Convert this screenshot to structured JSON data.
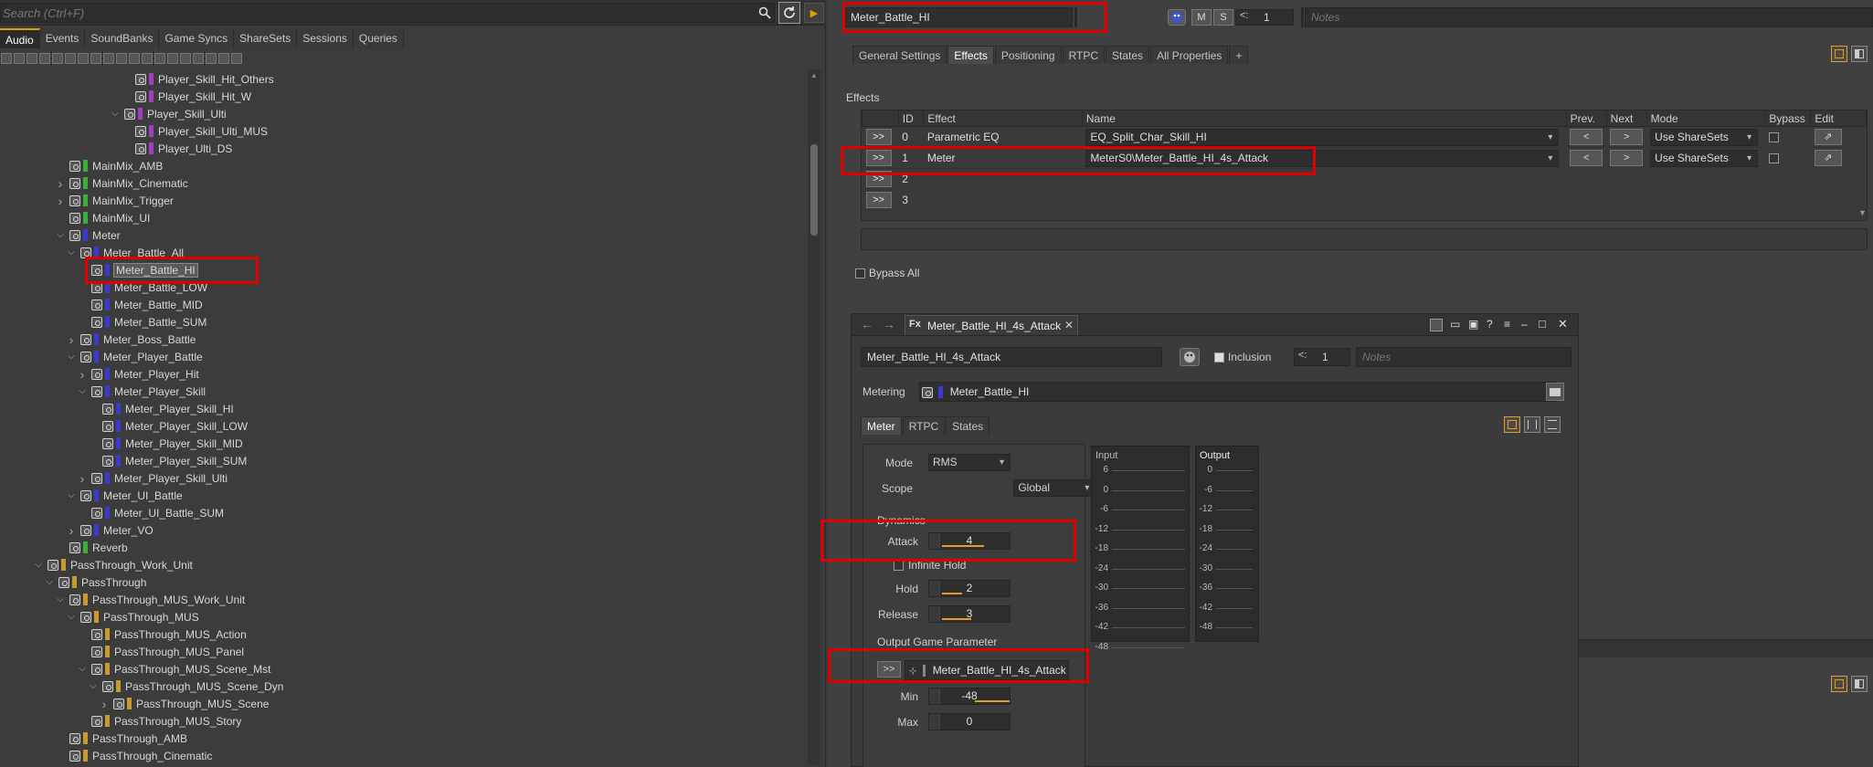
{
  "left": {
    "search_placeholder": "Search (Ctrl+F)",
    "tabs": [
      "Audio",
      "Events",
      "SoundBanks",
      "Game Syncs",
      "ShareSets",
      "Sessions",
      "Queries"
    ],
    "tree": [
      {
        "label": "Player_Skill_Hit_Others",
        "indent": 11,
        "color": "#a040c0",
        "twisty": ""
      },
      {
        "label": "Player_Skill_Hit_W",
        "indent": 11,
        "color": "#a040c0",
        "twisty": ""
      },
      {
        "label": "Player_Skill_Ulti",
        "indent": 10,
        "color": "#a040c0",
        "twisty": "v"
      },
      {
        "label": "Player_Skill_Ulti_MUS",
        "indent": 11,
        "color": "#a040c0",
        "twisty": ""
      },
      {
        "label": "Player_Ulti_DS",
        "indent": 11,
        "color": "#a040c0",
        "twisty": ""
      },
      {
        "label": "MainMix_AMB",
        "indent": 5,
        "color": "#3cae3c",
        "twisty": ""
      },
      {
        "label": "MainMix_Cinematic",
        "indent": 5,
        "color": "#3cae3c",
        "twisty": ">"
      },
      {
        "label": "MainMix_Trigger",
        "indent": 5,
        "color": "#3cae3c",
        "twisty": ">"
      },
      {
        "label": "MainMix_UI",
        "indent": 5,
        "color": "#3cae3c",
        "twisty": ""
      },
      {
        "label": "Meter",
        "indent": 5,
        "color": "#3a3ad0",
        "twisty": "v"
      },
      {
        "label": "Meter_Battle_All",
        "indent": 6,
        "color": "#3a3ad0",
        "twisty": "v"
      },
      {
        "label": "Meter_Battle_HI",
        "indent": 7,
        "color": "#3a3ad0",
        "twisty": "",
        "selected": true
      },
      {
        "label": "Meter_Battle_LOW",
        "indent": 7,
        "color": "#3a3ad0",
        "twisty": ""
      },
      {
        "label": "Meter_Battle_MID",
        "indent": 7,
        "color": "#3a3ad0",
        "twisty": ""
      },
      {
        "label": "Meter_Battle_SUM",
        "indent": 7,
        "color": "#3a3ad0",
        "twisty": ""
      },
      {
        "label": "Meter_Boss_Battle",
        "indent": 6,
        "color": "#3a3ad0",
        "twisty": ">"
      },
      {
        "label": "Meter_Player_Battle",
        "indent": 6,
        "color": "#3a3ad0",
        "twisty": "v"
      },
      {
        "label": "Meter_Player_Hit",
        "indent": 7,
        "color": "#3a3ad0",
        "twisty": ">"
      },
      {
        "label": "Meter_Player_Skill",
        "indent": 7,
        "color": "#3a3ad0",
        "twisty": "v"
      },
      {
        "label": "Meter_Player_Skill_HI",
        "indent": 8,
        "color": "#3a3ad0",
        "twisty": ""
      },
      {
        "label": "Meter_Player_Skill_LOW",
        "indent": 8,
        "color": "#3a3ad0",
        "twisty": ""
      },
      {
        "label": "Meter_Player_Skill_MID",
        "indent": 8,
        "color": "#3a3ad0",
        "twisty": ""
      },
      {
        "label": "Meter_Player_Skill_SUM",
        "indent": 8,
        "color": "#3a3ad0",
        "twisty": ""
      },
      {
        "label": "Meter_Player_Skill_Ulti",
        "indent": 7,
        "color": "#3a3ad0",
        "twisty": ">"
      },
      {
        "label": "Meter_UI_Battle",
        "indent": 6,
        "color": "#3a3ad0",
        "twisty": "v"
      },
      {
        "label": "Meter_UI_Battle_SUM",
        "indent": 7,
        "color": "#3a3ad0",
        "twisty": ""
      },
      {
        "label": "Meter_VO",
        "indent": 6,
        "color": "#3a3ad0",
        "twisty": ">"
      },
      {
        "label": "Reverb",
        "indent": 5,
        "color": "#3cae3c",
        "twisty": ""
      },
      {
        "label": "PassThrough_Work_Unit",
        "indent": 3,
        "color": "#c99a30",
        "twisty": "v"
      },
      {
        "label": "PassThrough",
        "indent": 4,
        "color": "#c99a30",
        "twisty": "v"
      },
      {
        "label": "PassThrough_MUS_Work_Unit",
        "indent": 5,
        "color": "#c99a30",
        "twisty": "v"
      },
      {
        "label": "PassThrough_MUS",
        "indent": 6,
        "color": "#c99a30",
        "twisty": "v"
      },
      {
        "label": "PassThrough_MUS_Action",
        "indent": 7,
        "color": "#c99a30",
        "twisty": ""
      },
      {
        "label": "PassThrough_MUS_Panel",
        "indent": 7,
        "color": "#c99a30",
        "twisty": ""
      },
      {
        "label": "PassThrough_MUS_Scene_Mst",
        "indent": 7,
        "color": "#c99a30",
        "twisty": "v"
      },
      {
        "label": "PassThrough_MUS_Scene_Dyn",
        "indent": 8,
        "color": "#c99a30",
        "twisty": "v"
      },
      {
        "label": "PassThrough_MUS_Scene",
        "indent": 9,
        "color": "#c99a30",
        "twisty": ">"
      },
      {
        "label": "PassThrough_MUS_Story",
        "indent": 7,
        "color": "#c99a30",
        "twisty": ""
      },
      {
        "label": "PassThrough_AMB",
        "indent": 5,
        "color": "#c99a30",
        "twisty": ""
      },
      {
        "label": "PassThrough_Cinematic",
        "indent": 5,
        "color": "#c99a30",
        "twisty": ""
      }
    ]
  },
  "right": {
    "object_name": "Meter_Battle_HI",
    "m_label": "M",
    "s_label": "S",
    "ref_count": "1",
    "notes_placeholder": "Notes",
    "tabs": [
      "General Settings",
      "Effects",
      "Positioning",
      "RTPC",
      "States",
      "All Properties",
      "+"
    ],
    "effects_group_label": "Effects",
    "table_headers": [
      "",
      "ID",
      "Effect",
      "Name",
      "Prev.",
      "Next",
      "Mode",
      "Bypass",
      "Edit"
    ],
    "effects": [
      {
        "btn": ">>",
        "id": "0",
        "effect": "Parametric EQ",
        "name": "EQ_Split_Char_Skill_HI",
        "prev": "<",
        "next": ">",
        "mode": "Use ShareSets"
      },
      {
        "btn": ">>",
        "id": "1",
        "effect": "Meter",
        "name": "MeterS0\\Meter_Battle_HI_4s_Attack",
        "prev": "<",
        "next": ">",
        "mode": "Use ShareSets"
      },
      {
        "btn": ">>",
        "id": "2",
        "effect": "",
        "name": "",
        "prev": "",
        "next": "",
        "mode": ""
      },
      {
        "btn": ">>",
        "id": "3",
        "effect": "",
        "name": "",
        "prev": "",
        "next": "",
        "mode": ""
      }
    ],
    "bypass_all": "Bypass All"
  },
  "editor": {
    "tab_title": "Meter_Battle_HI_4s_Attack",
    "fx_label": "Fx",
    "name_value": "Meter_Battle_HI_4s_Attack",
    "inclusion_label": "Inclusion",
    "ref_count": "1",
    "notes_placeholder": "Notes",
    "metering_label": "Metering",
    "metering_value": "Meter_Battle_HI",
    "tabs": [
      "Meter",
      "RTPC",
      "States"
    ],
    "mode_label": "Mode",
    "mode_value": "RMS",
    "scope_label": "Scope",
    "scope_value": "Global",
    "dynamics_label": "Dynamics",
    "attack_label": "Attack",
    "attack_value": "4",
    "infinite_hold_label": "Infinite Hold",
    "hold_label": "Hold",
    "hold_value": "2",
    "release_label": "Release",
    "release_value": "3",
    "output_gp_label": "Output Game Parameter",
    "output_btn": ">>",
    "output_value": "Meter_Battle_HI_4s_Attack",
    "min_label": "Min",
    "min_value": "-48",
    "max_label": "Max",
    "max_value": "0",
    "input_label": "Input",
    "input_scale": [
      "6",
      "0",
      "-6",
      "-12",
      "-18",
      "-24",
      "-30",
      "-36",
      "-42",
      "-48"
    ],
    "output_label": "Output",
    "output_scale": [
      "0",
      "-6",
      "-12",
      "-18",
      "-24",
      "-30",
      "-36",
      "-42",
      "-48"
    ]
  }
}
